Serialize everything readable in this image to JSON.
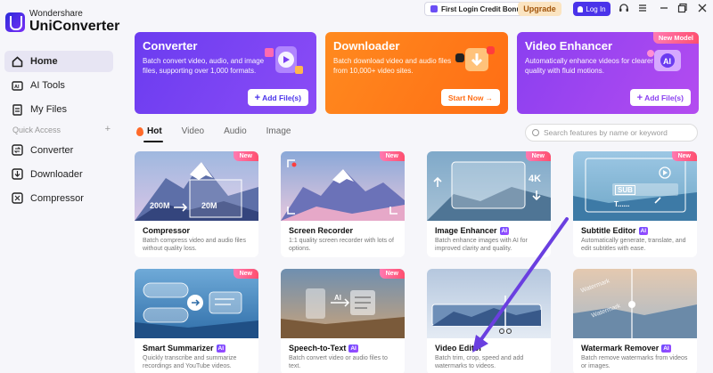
{
  "app": {
    "brand": "Wondershare",
    "name": "UniConverter"
  },
  "topbar": {
    "credit_bonus": "First Login Credit Bonus",
    "upgrade": "Upgrade",
    "login": "Log In"
  },
  "sidebar": {
    "items": [
      {
        "label": "Home",
        "icon": "home-icon",
        "active": true
      },
      {
        "label": "AI Tools",
        "icon": "ai-tools-icon"
      },
      {
        "label": "My Files",
        "icon": "my-files-icon"
      }
    ],
    "quick_access_label": "Quick Access",
    "quick_access_add": "+",
    "quick_items": [
      {
        "label": "Converter",
        "icon": "converter-icon"
      },
      {
        "label": "Downloader",
        "icon": "downloader-icon"
      },
      {
        "label": "Compressor",
        "icon": "compressor-icon"
      }
    ]
  },
  "hero": [
    {
      "title": "Converter",
      "desc": "Batch convert video, audio, and image files, supporting over 1,000 formats.",
      "button": "Add File(s)",
      "color": "#7b3ff2"
    },
    {
      "title": "Downloader",
      "desc": "Batch download video and audio files from 10,000+ video sites.",
      "button": "Start Now",
      "color": "#ff7a1a"
    },
    {
      "title": "Video Enhancer",
      "desc": "Automatically enhance videos for clearer quality with fluid motions.",
      "button": "Add File(s)",
      "badge": "New Model",
      "color": "#a53ff0"
    }
  ],
  "tabs": [
    {
      "label": "Hot",
      "active": true
    },
    {
      "label": "Video"
    },
    {
      "label": "Audio"
    },
    {
      "label": "Image"
    }
  ],
  "search": {
    "placeholder": "Search features by name or keyword"
  },
  "cards": [
    {
      "title": "Compressor",
      "ai": false,
      "new": true,
      "desc": "Batch compress video and audio files without quality loss.",
      "labels": [
        "200M",
        "20M"
      ]
    },
    {
      "title": "Screen Recorder",
      "ai": false,
      "new": true,
      "desc": "1:1 quality screen recorder with lots of options."
    },
    {
      "title": "Image Enhancer",
      "ai": true,
      "new": true,
      "desc": "Batch enhance images with AI for improved clarity and quality.",
      "labels": [
        "4K"
      ]
    },
    {
      "title": "Subtitle Editor",
      "ai": true,
      "new": true,
      "desc": "Automatically generate, translate, and edit subtitles with ease.",
      "labels": [
        "SUB",
        "T......"
      ]
    },
    {
      "title": "Smart Summarizer",
      "ai": true,
      "new": true,
      "desc": "Quickly transcribe and summarize recordings and YouTube videos."
    },
    {
      "title": "Speech-to-Text",
      "ai": true,
      "new": true,
      "desc": "Batch convert video or audio files to text.",
      "labels": [
        "AI"
      ]
    },
    {
      "title": "Video Editor",
      "ai": false,
      "new": false,
      "desc": "Batch trim, crop, speed and add watermarks to videos."
    },
    {
      "title": "Watermark Remover",
      "ai": true,
      "new": false,
      "desc": "Batch remove watermarks from videos or images.",
      "labels": [
        "Watermark"
      ]
    }
  ],
  "badges": {
    "new": "New",
    "ai": "AI"
  },
  "colors": {
    "accent": "#4a33ea",
    "pink_badge": "#ff5c8a",
    "orange": "#ff7a1a",
    "purple": "#7b3ff2",
    "arrow": "#6a3fe0"
  }
}
